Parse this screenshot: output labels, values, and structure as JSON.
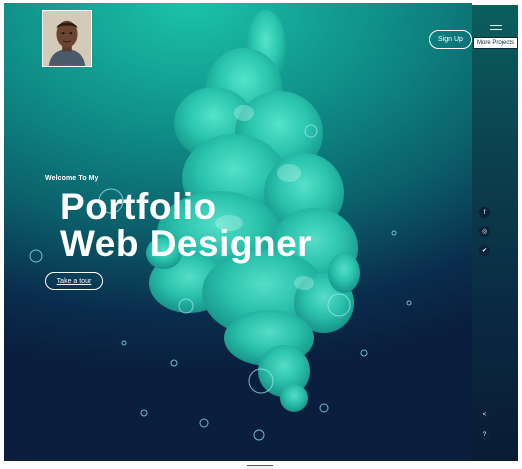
{
  "header": {
    "avatar": "profile-photo",
    "signup_label": "Sign Up"
  },
  "rail": {
    "menu_icon": "hamburger-icon",
    "more_projects_label": "More Projects",
    "social": [
      {
        "icon": "facebook-icon",
        "glyph": "f"
      },
      {
        "icon": "instagram-icon",
        "glyph": "◎"
      },
      {
        "icon": "twitter-icon",
        "glyph": "✔"
      }
    ],
    "bottom_icons": [
      {
        "icon": "share-icon",
        "glyph": "<"
      },
      {
        "icon": "help-icon",
        "glyph": "?"
      }
    ]
  },
  "hero": {
    "welcome": "Welcome To My",
    "title_line1": "Portfolio",
    "title_line2": "Web Designer",
    "tour_label": "Take a tour"
  },
  "colors": {
    "accent": "#2fd3b8",
    "background_top": "#1bc3a8",
    "background_bottom": "#0a1f3f"
  }
}
